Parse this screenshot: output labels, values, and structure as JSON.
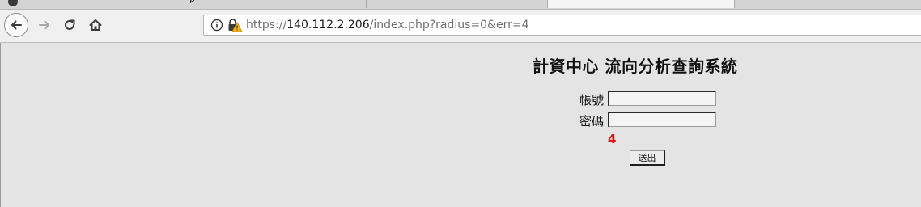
{
  "browser": {
    "tabs": [
      {
        "label": ""
      },
      {
        "label": "p"
      },
      {
        "label": ""
      },
      {
        "label": "",
        "active": true
      }
    ],
    "url": {
      "scheme": "https://",
      "host": "140.112.2.206",
      "path": "/index.php?radius=0&err=4"
    }
  },
  "page": {
    "title": "計資中心 流向分析查詢系統",
    "username_label": "帳號",
    "password_label": "密碼",
    "username_value": "",
    "password_value": "",
    "error_code": "4",
    "submit_label": "送出",
    "error_color": "#e01010"
  }
}
